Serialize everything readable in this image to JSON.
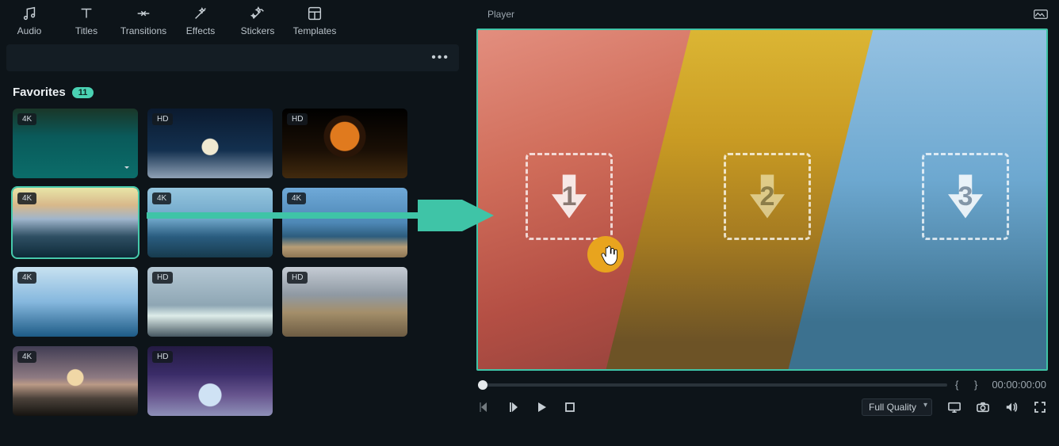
{
  "toolbar": {
    "tabs": [
      {
        "id": "audio",
        "label": "Audio"
      },
      {
        "id": "titles",
        "label": "Titles"
      },
      {
        "id": "transitions",
        "label": "Transitions"
      },
      {
        "id": "effects",
        "label": "Effects"
      },
      {
        "id": "stickers",
        "label": "Stickers"
      },
      {
        "id": "templates",
        "label": "Templates"
      }
    ]
  },
  "library": {
    "section_title": "Favorites",
    "count": "11",
    "items": [
      {
        "res": "4K",
        "style": "bg-island",
        "download": true,
        "selected": false
      },
      {
        "res": "HD",
        "style": "bg-xmas",
        "download": false,
        "selected": false
      },
      {
        "res": "HD",
        "style": "bg-robot",
        "download": false,
        "selected": false
      },
      {
        "res": "4K",
        "style": "bg-sunset",
        "download": false,
        "selected": true
      },
      {
        "res": "4K",
        "style": "bg-beach1",
        "download": false,
        "selected": false
      },
      {
        "res": "4K",
        "style": "bg-beach2",
        "download": false,
        "selected": false
      },
      {
        "res": "4K",
        "style": "bg-fantasy",
        "download": false,
        "selected": false
      },
      {
        "res": "HD",
        "style": "bg-ice",
        "download": false,
        "selected": false
      },
      {
        "res": "HD",
        "style": "bg-city",
        "download": false,
        "selected": false
      },
      {
        "res": "4K",
        "style": "bg-dusk",
        "download": false,
        "selected": false
      },
      {
        "res": "HD",
        "style": "bg-crystal",
        "download": false,
        "selected": false
      }
    ]
  },
  "player": {
    "title": "Player",
    "drop_zones": [
      "1",
      "2",
      "3"
    ],
    "quality_selected": "Full Quality",
    "quality_options": [
      "Full Quality"
    ],
    "timecode": "00:00:00:00",
    "braces": "{    }"
  },
  "colors": {
    "accent": "#3fc4a7"
  }
}
